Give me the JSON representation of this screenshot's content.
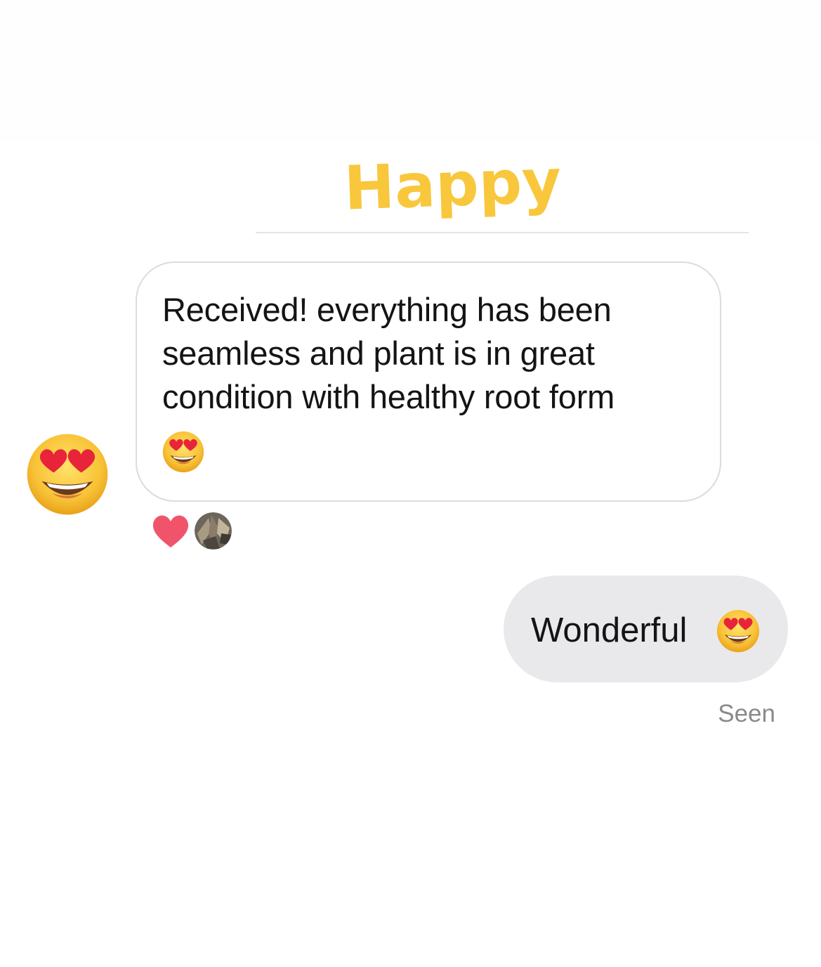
{
  "header": {
    "title": "Happy",
    "title_color": "#f9c73c"
  },
  "messages": [
    {
      "direction": "received",
      "text": "Received! everything has been seamless and plant is in great condition with healthy root form",
      "trailing_emoji": "heart-eyes-emoji",
      "reactions": [
        "heart-icon",
        "reactor-avatar"
      ]
    },
    {
      "direction": "sent",
      "text": "Wonderful",
      "trailing_emoji": "heart-eyes-emoji"
    }
  ],
  "status": {
    "seen_label": "Seen"
  },
  "colors": {
    "sent_bubble": "#e9e9ec",
    "received_border": "#dcdcdc",
    "heart": "#f0546b",
    "seen_text": "#8a8a8a"
  }
}
